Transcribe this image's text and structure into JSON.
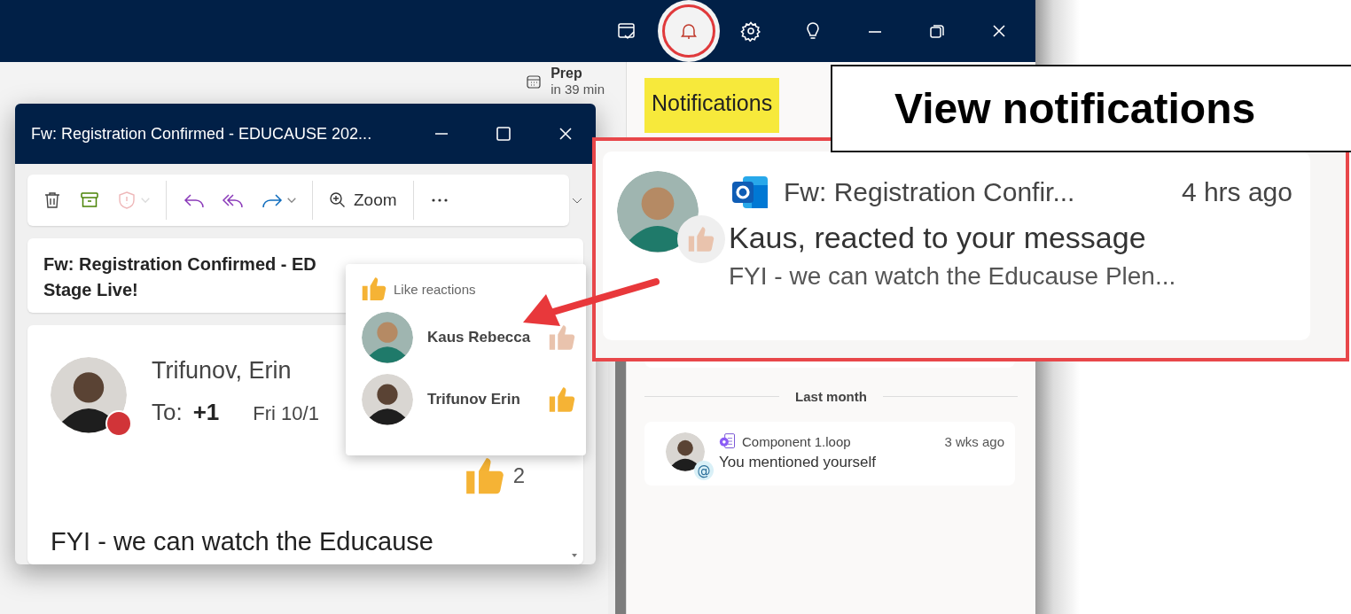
{
  "title_bar": {
    "icons": [
      {
        "kind": "tasks",
        "circled": false
      },
      {
        "kind": "bell",
        "circled": true
      },
      {
        "kind": "settings",
        "circled": false
      },
      {
        "kind": "bulb",
        "circled": false
      },
      {
        "kind": "minimize",
        "circled": false
      },
      {
        "kind": "restore",
        "circled": false
      },
      {
        "kind": "close",
        "circled": false
      }
    ]
  },
  "agenda": {
    "title": "Prep",
    "subtitle": "in 39 min"
  },
  "message_window": {
    "title": "Fw: Registration Confirmed - EDUCAUSE 202...",
    "toolbar": [
      {
        "kind": "delete",
        "disabled": false
      },
      {
        "kind": "archive",
        "disabled": false
      },
      {
        "kind": "report",
        "disabled": true
      },
      {
        "kind": "reply",
        "disabled": false
      },
      {
        "kind": "reply_all",
        "disabled": false
      },
      {
        "kind": "forward",
        "disabled": false
      },
      {
        "kind": "zoom",
        "label": "Zoom",
        "disabled": false
      },
      {
        "kind": "more",
        "disabled": false
      }
    ],
    "subject_lines": [
      "Fw: Registration Confirmed - ED",
      "Stage Live!"
    ],
    "sender": {
      "name": "Trifunov, Erin"
    },
    "to_label": "To:",
    "to_count": "+1",
    "date": "Fri 10/1",
    "reaction_count": "2",
    "body": "FYI - we can watch the Educause"
  },
  "reactions_popup": {
    "title": "Like reactions",
    "people": [
      {
        "name": "Kaus Rebecca",
        "color": "#e9c3ad"
      },
      {
        "name": "Trifunov Erin",
        "color": "#f5b335"
      }
    ]
  },
  "notifications": {
    "title": "Notifications",
    "highlighted": true,
    "groups": [
      {
        "heading": "Last month",
        "items": [
          {
            "source": "Component 1.loop",
            "time": "3 wks ago",
            "text": "You mentioned yourself",
            "badge": "@"
          }
        ]
      }
    ]
  },
  "callout": {
    "source": "Fw: Registration Confir...",
    "time": "4 hrs ago",
    "text": "Kaus, reacted to your message",
    "preview": "FYI - we can watch the Educause Plen..."
  },
  "label": "View notifications"
}
